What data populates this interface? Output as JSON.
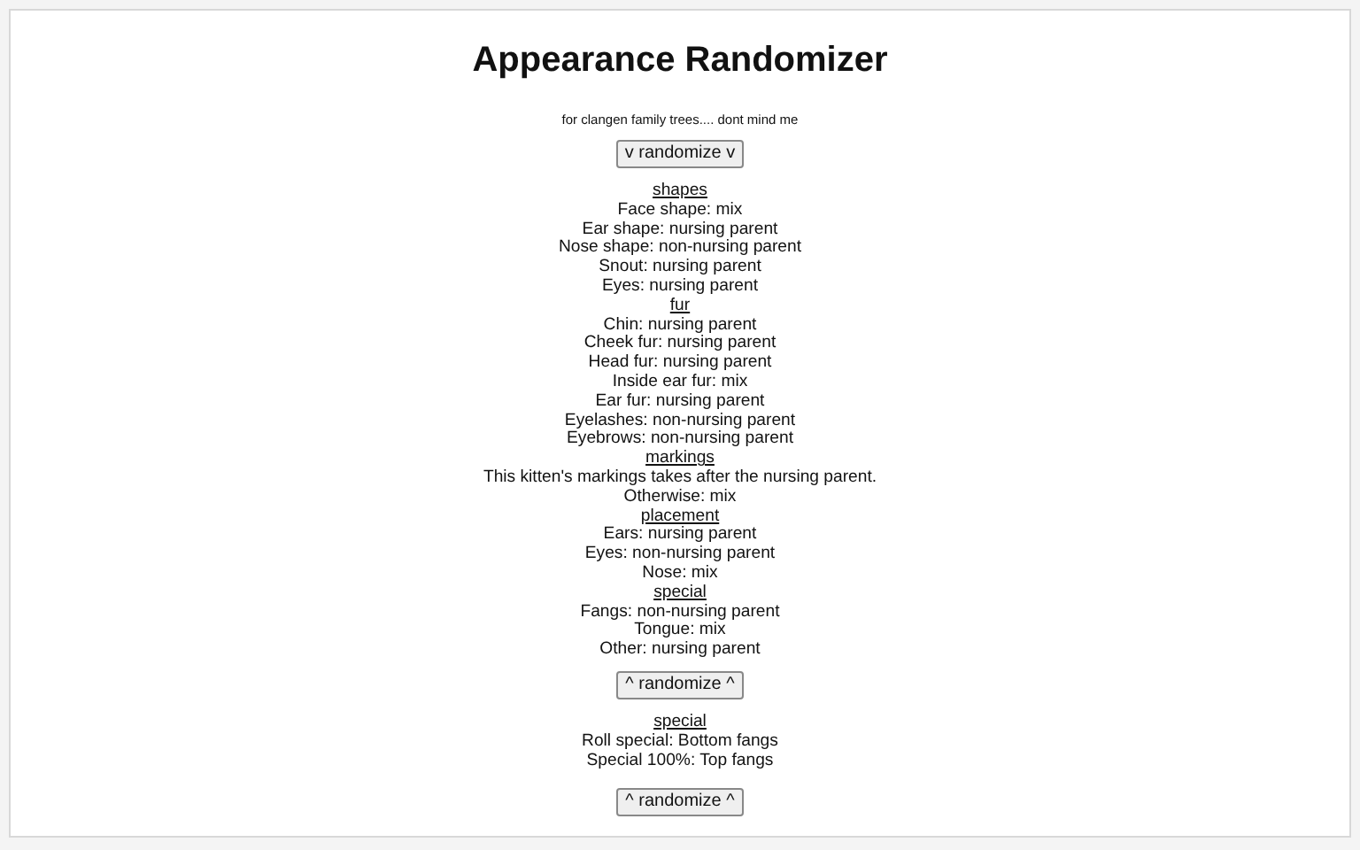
{
  "title": "Appearance Randomizer",
  "subtitle": "for clangen family trees.... dont mind me",
  "blocks": [
    {
      "kind": "button",
      "text": "v randomize v"
    },
    {
      "kind": "heading",
      "text": "shapes"
    },
    {
      "kind": "line",
      "text": "Face shape: mix"
    },
    {
      "kind": "line",
      "text": "Ear shape: nursing parent"
    },
    {
      "kind": "line",
      "text": "Nose shape: non-nursing parent"
    },
    {
      "kind": "line",
      "text": "Snout: nursing parent"
    },
    {
      "kind": "line",
      "text": "Eyes: nursing parent"
    },
    {
      "kind": "heading",
      "text": "fur"
    },
    {
      "kind": "line",
      "text": "Chin: nursing parent"
    },
    {
      "kind": "line",
      "text": "Cheek fur: nursing parent"
    },
    {
      "kind": "line",
      "text": "Head fur: nursing parent"
    },
    {
      "kind": "line",
      "text": "Inside ear fur: mix"
    },
    {
      "kind": "line",
      "text": "Ear fur: nursing parent"
    },
    {
      "kind": "line",
      "text": "Eyelashes: non-nursing parent"
    },
    {
      "kind": "line",
      "text": "Eyebrows: non-nursing parent"
    },
    {
      "kind": "heading",
      "text": "markings"
    },
    {
      "kind": "line",
      "text": "This kitten's markings takes after the nursing parent."
    },
    {
      "kind": "line",
      "text": "Otherwise: mix"
    },
    {
      "kind": "heading",
      "text": "placement"
    },
    {
      "kind": "line",
      "text": "Ears: nursing parent"
    },
    {
      "kind": "line",
      "text": "Eyes: non-nursing parent"
    },
    {
      "kind": "line",
      "text": "Nose: mix"
    },
    {
      "kind": "heading",
      "text": "special"
    },
    {
      "kind": "line",
      "text": "Fangs: non-nursing parent"
    },
    {
      "kind": "line",
      "text": "Tongue: mix"
    },
    {
      "kind": "line",
      "text": "Other: nursing parent"
    },
    {
      "kind": "button",
      "text": "^ randomize ^"
    },
    {
      "kind": "heading",
      "text": "special"
    },
    {
      "kind": "line",
      "text": "Roll special: Bottom fangs"
    },
    {
      "kind": "line",
      "text": "Special 100%: Top fangs"
    },
    {
      "kind": "button",
      "text": "^ randomize ^"
    }
  ]
}
